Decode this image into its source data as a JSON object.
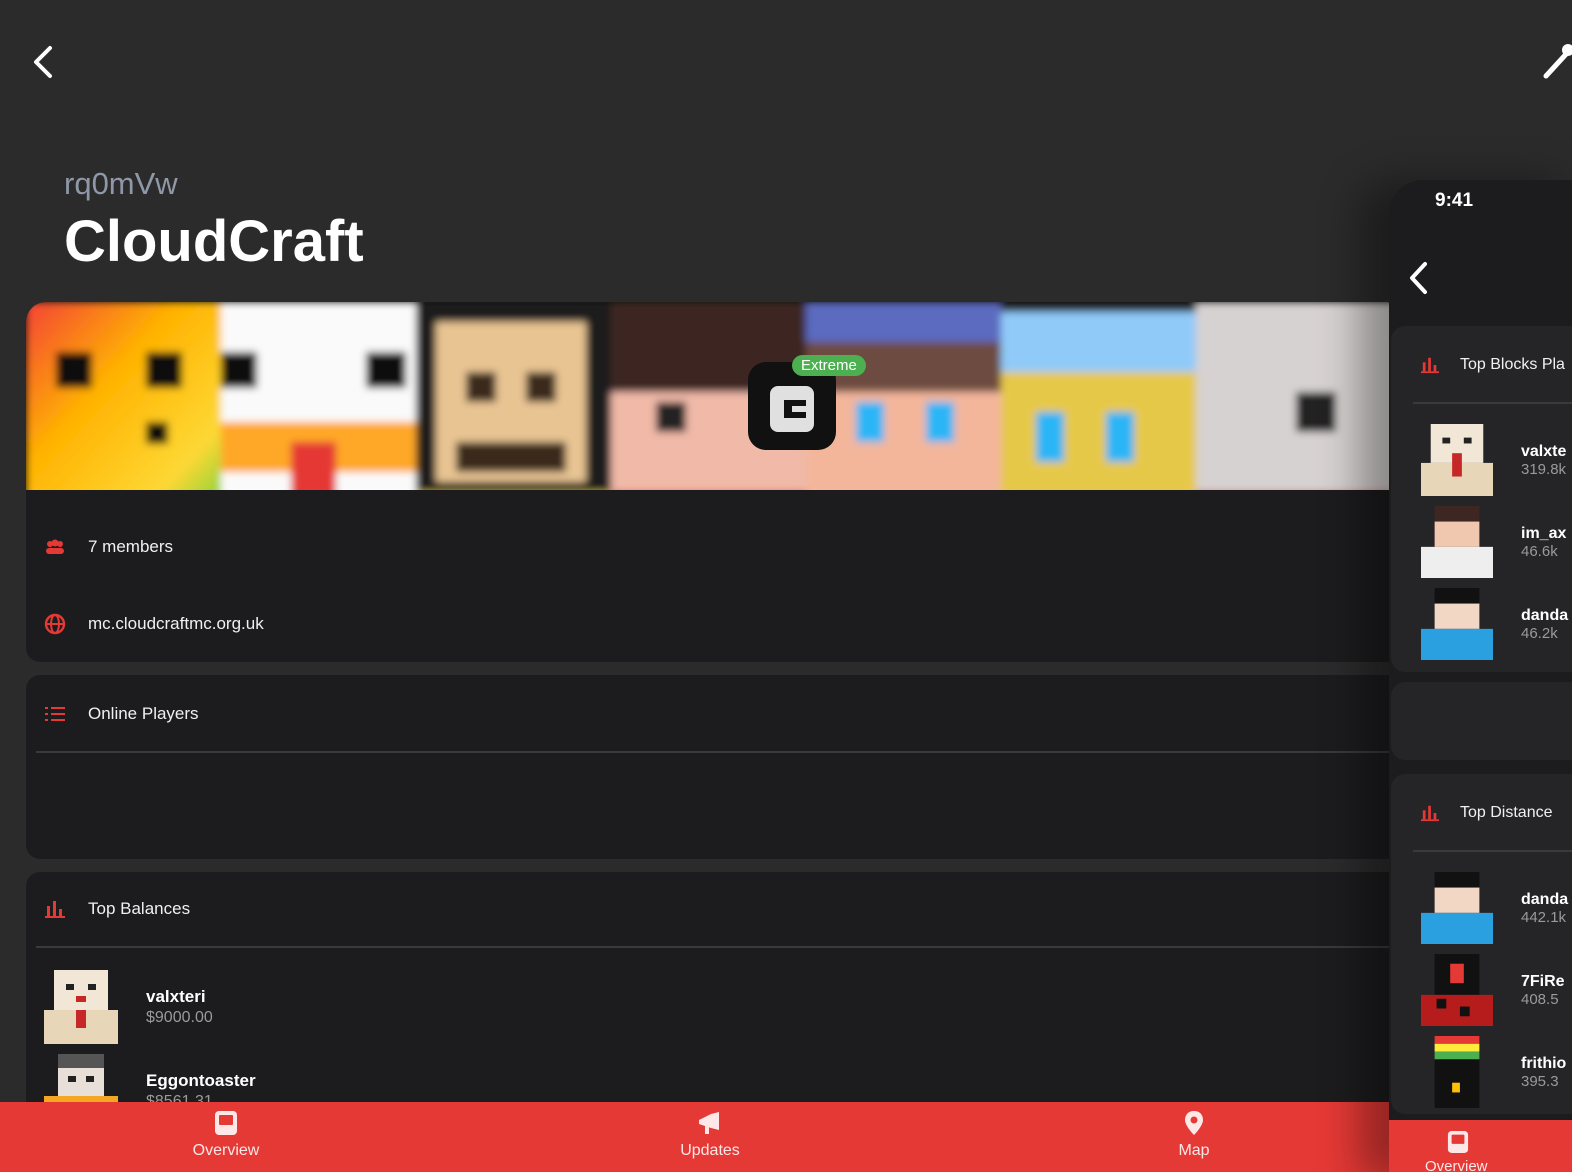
{
  "header": {
    "server_id": "rq0mVw",
    "server_name": "CloudCraft",
    "back_icon": "chevron-left-icon",
    "tool_icon": "wrench-icon"
  },
  "banner": {
    "badge_label": "Extreme",
    "badge_color": "#4caf50",
    "logo_letter": "C"
  },
  "info": {
    "members": "7 members",
    "address": "mc.cloudcraftmc.org.uk"
  },
  "online_players": {
    "title": "Online Players"
  },
  "top_balances": {
    "title": "Top Balances",
    "players": [
      {
        "name": "valxteri",
        "value": "$9000.00"
      },
      {
        "name": "Eggontoaster",
        "value": "$8561.31"
      }
    ]
  },
  "tabbar": {
    "color": "#e53935",
    "tabs": [
      {
        "label": "Overview",
        "icon": "overview-icon"
      },
      {
        "label": "Updates",
        "icon": "megaphone-icon"
      },
      {
        "label": "Map",
        "icon": "map-pin-icon"
      }
    ]
  },
  "second_device": {
    "time": "9:41",
    "blocks_card": {
      "title": "Top Blocks Pla",
      "players": [
        {
          "name": "valxte",
          "value": "319.8k"
        },
        {
          "name": "im_ax",
          "value": "46.6k"
        },
        {
          "name": "danda",
          "value": "46.2k"
        }
      ]
    },
    "distance_card": {
      "title": "Top Distance",
      "players": [
        {
          "name": "danda",
          "value": "442.1k"
        },
        {
          "name": "7FiRe",
          "value": "408.5"
        },
        {
          "name": "frithio",
          "value": "395.3"
        }
      ]
    },
    "tab_label": "Overview"
  },
  "colors": {
    "accent": "#e53935",
    "background": "#2b2b2b",
    "card": "#1c1c1e"
  }
}
